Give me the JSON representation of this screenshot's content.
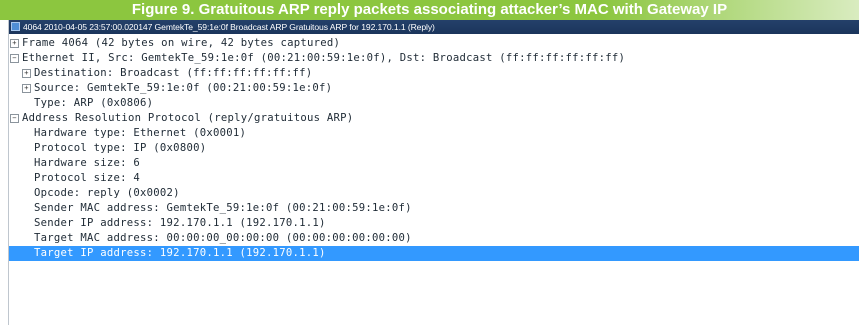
{
  "caption": {
    "figure_number": "Figure 9.",
    "title": "Gratuitous ARP reply packets associating attacker’s MAC with Gateway IP"
  },
  "window": {
    "title": "4064 2010-04-05 23:57:00.020147 GemtekTe_59:1e:0f Broadcast ARP Gratuitous ARP for 192.170.1.1 (Reply)",
    "icon": "wireshark-packet-icon"
  },
  "tree": {
    "frame": "Frame 4064 (42 bytes on wire, 42 bytes captured)",
    "ethernet": "Ethernet II, Src: GemtekTe_59:1e:0f (00:21:00:59:1e:0f), Dst: Broadcast (ff:ff:ff:ff:ff:ff)",
    "destination": "Destination: Broadcast (ff:ff:ff:ff:ff:ff)",
    "source": "Source: GemtekTe_59:1e:0f (00:21:00:59:1e:0f)",
    "type": "Type: ARP (0x0806)",
    "arp": "Address Resolution Protocol (reply/gratuitous ARP)",
    "hw_type": "Hardware type: Ethernet (0x0001)",
    "proto_type": "Protocol type: IP (0x0800)",
    "hw_size": "Hardware size: 6",
    "proto_size": "Protocol size: 4",
    "opcode": "Opcode: reply (0x0002)",
    "sender_mac": "Sender MAC address: GemtekTe_59:1e:0f (00:21:00:59:1e:0f)",
    "sender_ip": "Sender IP address: 192.170.1.1 (192.170.1.1)",
    "target_mac": "Target MAC address: 00:00:00_00:00:00 (00:00:00:00:00:00)",
    "target_ip": "Target IP address: 192.170.1.1 (192.170.1.1)"
  },
  "toggles": {
    "collapsed": "+",
    "expanded": "−"
  },
  "colors": {
    "caption_bg": "#8cc63f",
    "titlebar_bg": "#1b355c",
    "selection_bg": "#3399ff"
  }
}
